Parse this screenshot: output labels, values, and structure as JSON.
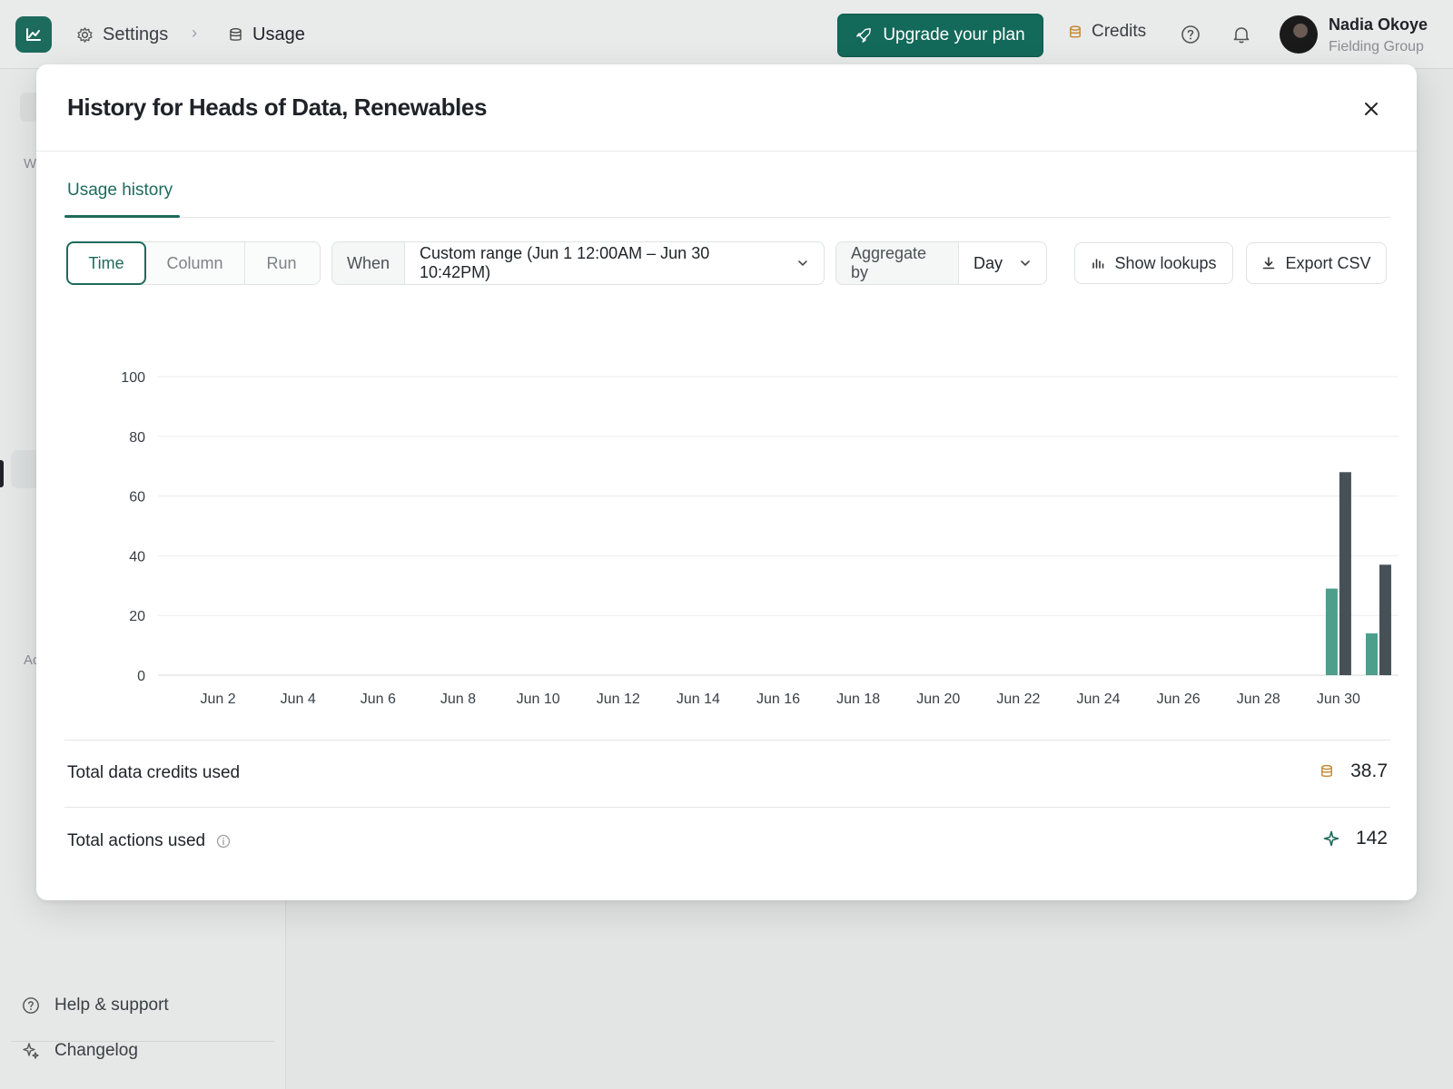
{
  "topbar": {
    "settings_label": "Settings",
    "usage_label": "Usage",
    "upgrade_label": "Upgrade your plan",
    "credits_label": "Credits",
    "user_name": "Nadia Okoye",
    "user_org": "Fielding Group"
  },
  "sidebar": {
    "section_w": "W",
    "section_a": "Ac",
    "help_label": "Help & support",
    "changelog_label": "Changelog"
  },
  "modal": {
    "title": "History for Heads of Data, Renewables",
    "tab_label": "Usage history",
    "view_options": [
      "Time",
      "Column",
      "Run"
    ],
    "view_selected": "Time",
    "when_label": "When",
    "when_value": "Custom range (Jun 1 12:00AM – Jun 30 10:42PM)",
    "aggregate_label": "Aggregate by",
    "aggregate_value": "Day",
    "show_lookups_label": "Show lookups",
    "export_label": "Export CSV",
    "total_credits_label": "Total data credits used",
    "total_credits_value": "38.7",
    "total_actions_label": "Total actions used",
    "total_actions_value": "142"
  },
  "colors": {
    "brand": "#1d6b5c",
    "series_credits": "#4e9e8c",
    "series_actions": "#465157",
    "credits_icon": "#c7862f"
  },
  "chart_data": {
    "type": "bar",
    "ylim": [
      0,
      100
    ],
    "yticks": [
      0,
      20,
      40,
      60,
      80,
      100
    ],
    "x_tick_labels": [
      "Jun 2",
      "Jun 4",
      "Jun 6",
      "Jun 8",
      "Jun 10",
      "Jun 12",
      "Jun 14",
      "Jun 16",
      "Jun 18",
      "Jun 20",
      "Jun 22",
      "Jun 24",
      "Jun 26",
      "Jun 28",
      "Jun 30"
    ],
    "categories": [
      "Jun 1",
      "Jun 2",
      "Jun 3",
      "Jun 4",
      "Jun 5",
      "Jun 6",
      "Jun 7",
      "Jun 8",
      "Jun 9",
      "Jun 10",
      "Jun 11",
      "Jun 12",
      "Jun 13",
      "Jun 14",
      "Jun 15",
      "Jun 16",
      "Jun 17",
      "Jun 18",
      "Jun 19",
      "Jun 20",
      "Jun 21",
      "Jun 22",
      "Jun 23",
      "Jun 24",
      "Jun 25",
      "Jun 26",
      "Jun 27",
      "Jun 28",
      "Jun 29",
      "Jun 30",
      "Jul 1"
    ],
    "series": [
      {
        "values": [
          0,
          0,
          0,
          0,
          0,
          0,
          0,
          0,
          0,
          0,
          0,
          0,
          0,
          0,
          0,
          0,
          0,
          0,
          0,
          0,
          0,
          0,
          0,
          0,
          0,
          0,
          0,
          0,
          0,
          29,
          14
        ]
      },
      {
        "values": [
          0,
          0,
          0,
          0,
          0,
          0,
          0,
          0,
          0,
          0,
          0,
          0,
          0,
          0,
          0,
          0,
          0,
          0,
          0,
          0,
          0,
          0,
          0,
          0,
          0,
          0,
          0,
          0,
          0,
          68,
          37
        ]
      }
    ],
    "grid": true,
    "legend": false
  }
}
